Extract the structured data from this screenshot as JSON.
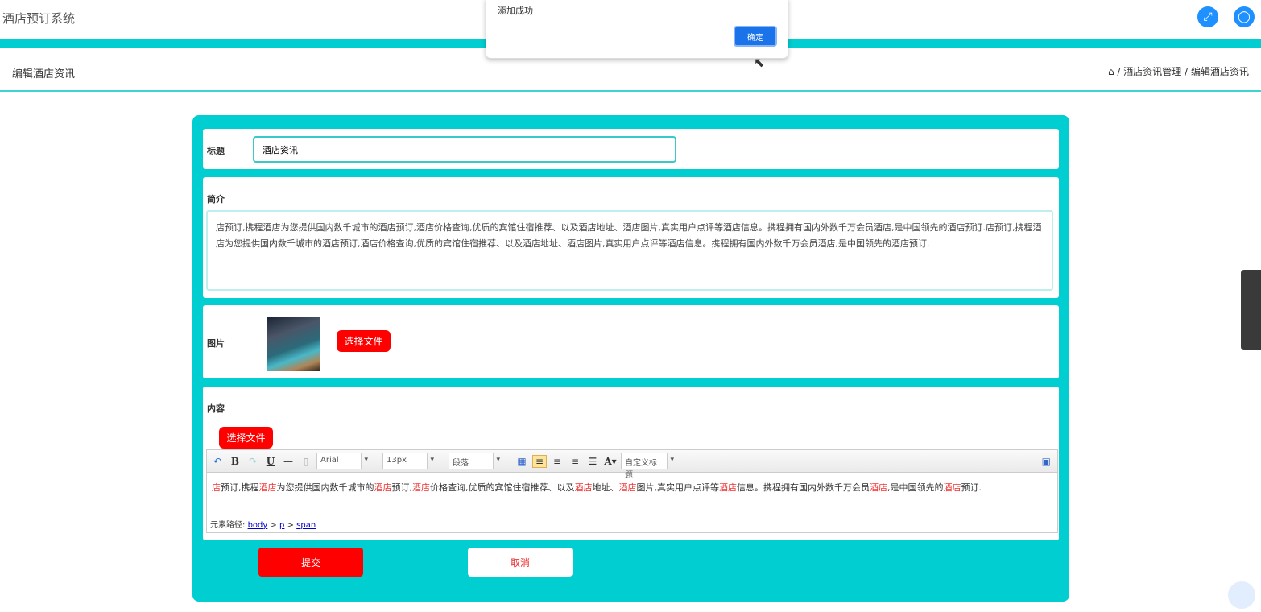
{
  "header": {
    "app_title": "酒店预订系统",
    "fullscreen_icon": "expand-icon",
    "user_icon": "user-icon"
  },
  "subheader": {
    "page_title": "编辑酒店资讯",
    "breadcrumb": [
      "酒店资讯管理",
      "编辑酒店资讯"
    ],
    "home_icon": "home-icon",
    "separator": "/"
  },
  "form": {
    "title_label": "标题",
    "title_value": "酒店资讯",
    "intro_label": "简介",
    "intro_value": "店预订,携程酒店为您提供国内数千城市的酒店预订,酒店价格查询,优质的宾馆住宿推荐、以及酒店地址、酒店图片,真实用户点评等酒店信息。携程拥有国内外数千万会员酒店,是中国领先的酒店预订.店预订,携程酒店为您提供国内数千城市的酒店预订,酒店价格查询,优质的宾馆住宿推荐、以及酒店地址、酒店图片,真实用户点评等酒店信息。携程拥有国内外数千万会员酒店,是中国领先的酒店预订.",
    "image_label": "图片",
    "choose_file": "选择文件",
    "content_label": "内容",
    "content_choose_file": "选择文件",
    "editor": {
      "font": "Arial",
      "size": "13px",
      "paragraph": "段落",
      "custom_title": "自定义标题",
      "content_segments": [
        {
          "t": "店",
          "hl": true
        },
        {
          "t": "预订,携程"
        },
        {
          "t": "酒店",
          "hl": true
        },
        {
          "t": "为您提供国内数千城市的"
        },
        {
          "t": "酒店",
          "hl": true
        },
        {
          "t": "预订,"
        },
        {
          "t": "酒店",
          "hl": true
        },
        {
          "t": "价格查询,优质的宾馆住宿推荐、以及"
        },
        {
          "t": "酒店",
          "hl": true
        },
        {
          "t": "地址、"
        },
        {
          "t": "酒店",
          "hl": true
        },
        {
          "t": "图片,真实用户点评等"
        },
        {
          "t": "酒店",
          "hl": true
        },
        {
          "t": "信息。携程拥有国内外数千万会员"
        },
        {
          "t": "酒店",
          "hl": true
        },
        {
          "t": ",是中国领先的"
        },
        {
          "t": "酒店",
          "hl": true
        },
        {
          "t": "预订."
        }
      ],
      "path_label": "元素路径:",
      "path": [
        "body",
        "p",
        "span"
      ]
    },
    "submit": "提交",
    "cancel": "取消"
  },
  "dialog": {
    "message": "添加成功",
    "ok": "确定"
  },
  "colors": {
    "teal": "#00ced1",
    "red": "#ff0000",
    "blue": "#1e90ff"
  }
}
